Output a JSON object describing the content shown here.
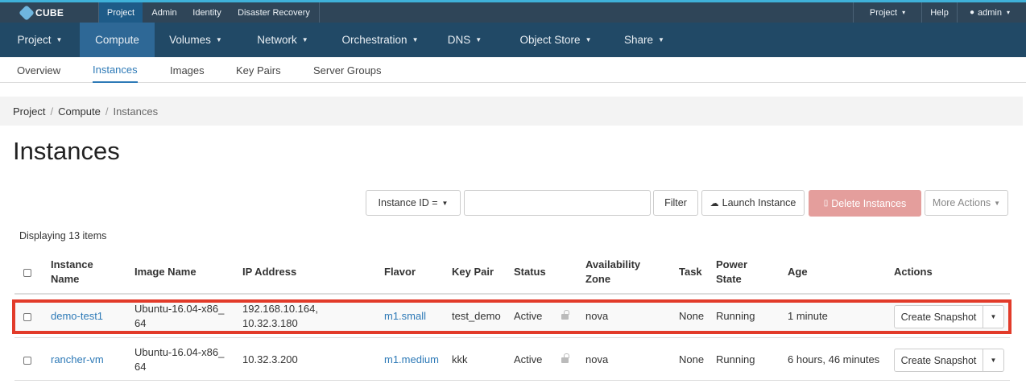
{
  "topbar": {
    "brand": "CUBE",
    "tabs": [
      "Project",
      "Admin",
      "Identity",
      "Disaster Recovery"
    ],
    "project_menu": "Project",
    "help": "Help",
    "user": "admin"
  },
  "mainnav": [
    "Project",
    "Compute",
    "Volumes",
    "Network",
    "Orchestration",
    "DNS",
    "Object Store",
    "Share"
  ],
  "subnav": [
    "Overview",
    "Instances",
    "Images",
    "Key Pairs",
    "Server Groups"
  ],
  "breadcrumb": [
    "Project",
    "Compute",
    "Instances"
  ],
  "page_title": "Instances",
  "toolbar": {
    "filter_field": "Instance ID =",
    "search_value": "",
    "filter_button": "Filter",
    "launch_button": "Launch Instance",
    "delete_button": "Delete Instances",
    "more_button": "More Actions"
  },
  "display_count": "Displaying 13 items",
  "table": {
    "headers": {
      "name_line1": "Instance",
      "name_line2": "Name",
      "image": "Image Name",
      "ip": "IP Address",
      "flavor": "Flavor",
      "keypair": "Key Pair",
      "status": "Status",
      "az_line1": "Availability",
      "az_line2": "Zone",
      "task": "Task",
      "power_line1": "Power",
      "power_line2": "State",
      "age": "Age",
      "actions": "Actions"
    },
    "rows": [
      {
        "name": "demo-test1",
        "image_line1": "Ubuntu-16.04-x86_",
        "image_line2": "64",
        "ip_line1": "192.168.10.164,",
        "ip_line2": "10.32.3.180",
        "flavor": "m1.small",
        "keypair": "test_demo",
        "status": "Active",
        "az": "nova",
        "task": "None",
        "power": "Running",
        "age": "1 minute",
        "action": "Create Snapshot"
      },
      {
        "name": "rancher-vm",
        "image_line1": "Ubuntu-16.04-x86_",
        "image_line2": "64",
        "ip_line1": "10.32.3.200",
        "ip_line2": "",
        "flavor": "m1.medium",
        "keypair": "kkk",
        "status": "Active",
        "az": "nova",
        "task": "None",
        "power": "Running",
        "age": "6 hours, 46 minutes",
        "action": "Create Snapshot"
      }
    ]
  }
}
